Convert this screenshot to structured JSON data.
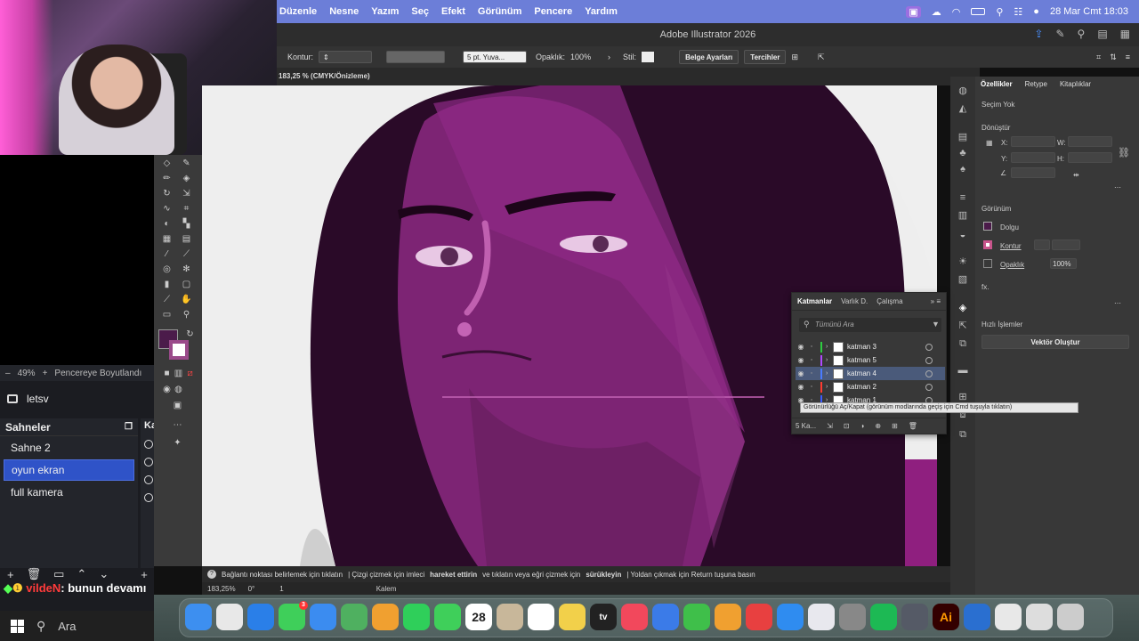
{
  "obs": {
    "zoom_minus": "–",
    "zoom_level": "49%",
    "zoom_plus": "+",
    "fit_label": "Pencereye Boyutlandı",
    "scene_title": "letsv",
    "scenes_header": "Sahneler",
    "sources_header": "Ka",
    "scenes": [
      {
        "label": "Sahne 2"
      },
      {
        "label": "oyun ekran"
      },
      {
        "label": "full kamera"
      }
    ],
    "chat_user": "vildeN",
    "chat_message": ": bunun devamı"
  },
  "taskbar": {
    "search_label": "Ara"
  },
  "menubar": {
    "items": [
      "Düzenle",
      "Nesne",
      "Yazım",
      "Seç",
      "Efekt",
      "Görünüm",
      "Pencere",
      "Yardım"
    ],
    "datetime": "28 Mar Cmt  18:03"
  },
  "app": {
    "title": "Adobe Illustrator 2026",
    "doc_tab": "183,25 % (CMYK/Önizleme)"
  },
  "controlbar": {
    "stroke_label": "Kontur:",
    "brush_value": "5 pt. Yuva...",
    "opacity_label": "Opaklık:",
    "opacity_value": "100%",
    "style_label": "Stil:",
    "doc_setup_btn": "Belge Ayarları",
    "prefs_btn": "Tercihler"
  },
  "statusbar": {
    "hint_prefix": "Bağlantı noktası belirlemek için tıklatın",
    "hint_bold1": "hareket ettirin",
    "hint_mid": "| Çizgi çizmek için imleci",
    "hint_mid2": "ve tıklatın veya eğri çizmek için",
    "hint_bold2": "sürükleyin",
    "hint_end": "| Yoldan çıkmak için Return tuşuna basın",
    "zoom": "183,25%",
    "angle": "0°",
    "artboard": "1",
    "tool_name": "Kalem"
  },
  "properties": {
    "tabs": [
      "Özellikler",
      "Retype",
      "Kitaplıklar"
    ],
    "selection": "Seçim Yok",
    "transform": "Dönüştür",
    "x_label": "X:",
    "y_label": "Y:",
    "w_label": "W:",
    "h_label": "H:",
    "appearance": "Görünüm",
    "fill_label": "Dolgu",
    "stroke_label": "Kontur",
    "opacity_label": "Opaklık",
    "opacity_value": "100%",
    "fx": "fx.",
    "quick_actions": "Hızlı İşlemler",
    "vector_btn": "Vektör Oluştur"
  },
  "layers": {
    "tabs": [
      "Katmanlar",
      "Varlık D.",
      "Çalışma"
    ],
    "search_placeholder": "Tümünü Ara",
    "rows": [
      {
        "name": "katman 3",
        "color": "#2ecc40"
      },
      {
        "name": "katman 5",
        "color": "#b049ff"
      },
      {
        "name": "katman 4",
        "color": "#4a7bff"
      },
      {
        "name": "katman 2",
        "color": "#ff3b30"
      },
      {
        "name": "katman 1",
        "color": "#3b5bff"
      }
    ],
    "count": "5 Ka...",
    "tooltip": "Görünürlüğü Aç/Kapat (görünüm modlarında geçiş için Cmd tuşuyla tıklatın)"
  },
  "colors": {
    "menubar": "#6c7ed8",
    "fill_swatch": "#4b1b4a",
    "art_bg": "#2a0a28",
    "art_face": "#8f2a86",
    "obs_selected": "#2f53c8"
  },
  "dock": {
    "apps": [
      "finder-icon",
      "launchpad-icon",
      "safari-icon",
      "messages-icon",
      "mail-icon",
      "maps-icon",
      "photos-icon",
      "facetime-icon",
      "phone-icon",
      "calendar-icon",
      "contacts-icon",
      "reminders-icon",
      "notes-icon",
      "appletv-icon",
      "music-icon",
      "keynote-icon",
      "numbers-icon",
      "pages-icon",
      "rocket-icon",
      "appstore-icon",
      "iphone-mirroring-icon",
      "settings-icon",
      "spotify-icon",
      "disk-utility-icon",
      "illustrator-icon",
      "vpn-icon",
      "finder-doc-icon",
      "window-icon",
      "trash-icon"
    ],
    "calendar_day": "28",
    "messages_badge": "3",
    "tv_label": "tv",
    "ai_label": "Ai"
  }
}
